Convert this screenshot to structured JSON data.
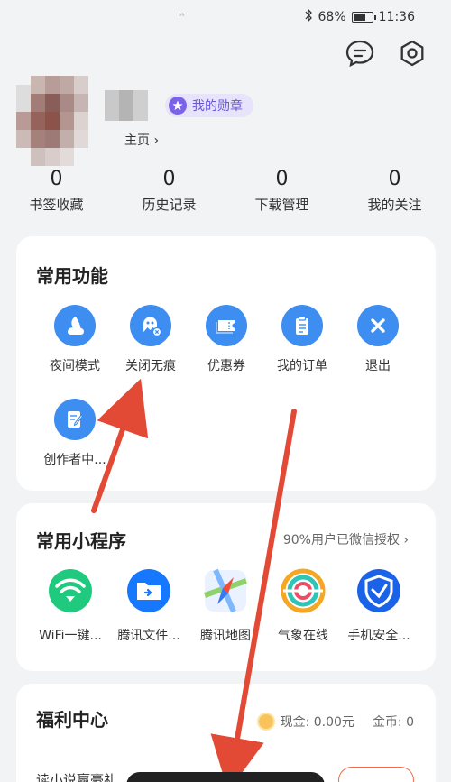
{
  "status_bar": {
    "signal": "ᵇˡᶦ",
    "battery": "68%",
    "battery_level": 0.68,
    "time": "11:36"
  },
  "header": {
    "icons": [
      "message-icon",
      "settings-icon"
    ],
    "medal_label": "我的勋章",
    "homepage_link": "主页 ›"
  },
  "stats": [
    {
      "value": "0",
      "label": "书签收藏"
    },
    {
      "value": "0",
      "label": "历史记录"
    },
    {
      "value": "0",
      "label": "下载管理"
    },
    {
      "value": "0",
      "label": "我的关注"
    }
  ],
  "common_functions": {
    "title": "常用功能",
    "items": [
      {
        "label": "夜间模式",
        "icon": "night-mode-icon"
      },
      {
        "label": "关闭无痕",
        "icon": "incognito-off-icon"
      },
      {
        "label": "优惠券",
        "icon": "coupon-icon"
      },
      {
        "label": "我的订单",
        "icon": "orders-icon"
      },
      {
        "label": "退出",
        "icon": "exit-icon"
      },
      {
        "label": "创作者中...",
        "icon": "creator-center-icon"
      }
    ]
  },
  "mini_programs": {
    "title": "常用小程序",
    "auth_note": "90%用户已微信授权 ›",
    "items": [
      {
        "label": "WiFi一键...",
        "icon": "wifi-icon"
      },
      {
        "label": "腾讯文件...",
        "icon": "tencent-file-icon"
      },
      {
        "label": "腾讯地图",
        "icon": "tencent-map-icon"
      },
      {
        "label": "气象在线",
        "icon": "weather-icon"
      },
      {
        "label": "手机安全...",
        "icon": "phone-security-icon"
      }
    ]
  },
  "welfare": {
    "title": "福利中心",
    "cash": "现金: 0.00元",
    "gold": "金币: 0",
    "read_novel": "读小说赢豪礼"
  },
  "colors": {
    "accent_blue": "#3d8ef0",
    "arrow_red": "#e34a35",
    "medal_purple": "#6a56d9"
  }
}
